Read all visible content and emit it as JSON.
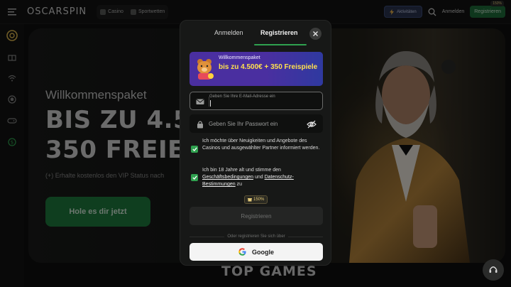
{
  "topbar": {
    "logo": "OSCARSPIN",
    "nav": [
      "Casino",
      "Sportwetten"
    ],
    "activate_label": "Aktivitäten",
    "login_label": "Anmelden",
    "register_label": "Registrieren",
    "register_badge": "150%"
  },
  "hero": {
    "subtitle": "Willkommenspaket",
    "title_line1": "BIS ZU 4.5",
    "title_line2": "350 FREIE",
    "vip": "(+) Erhalte kostenlos den VIP Status nach",
    "cta": "Hole es dir jetzt"
  },
  "section": {
    "top_games": "TOP GAMES"
  },
  "modal": {
    "tabs": {
      "login": "Anmelden",
      "register": "Registrieren",
      "active": "register"
    },
    "promo": {
      "small": "Willkommenspaket",
      "big": "bis zu 4.500€ + 350 Freispiele"
    },
    "email": {
      "label": "Geben Sie Ihre E-Mail-Adresse ein",
      "value": ""
    },
    "password": {
      "placeholder": "Geben Sie Ihr Passwort ein"
    },
    "consent_news": {
      "checked": true,
      "text": "Ich möchte über Neuigkeiten und Angebote des Casinos und ausgewählter Partner informiert werden."
    },
    "consent_terms": {
      "checked": true,
      "pre": "Ich bin 18 Jahre alt und stimme den",
      "terms_link": "Geschäftsbedingungen",
      "and": "und",
      "privacy_link": "Datenschutz-Bestimmungen",
      "post": "zu"
    },
    "bonus_badge": "150%",
    "submit": "Registrieren",
    "or_text": "Oder registrieren Sie sich über",
    "google": "Google"
  },
  "colors": {
    "accent_green": "#2fa14f",
    "promo_purple": "#4a2fa0",
    "promo_yellow": "#ffe04f"
  },
  "icons": [
    "menu-icon",
    "logo-icon",
    "casino-icon",
    "sport-icon",
    "search-icon",
    "mail-icon",
    "lock-icon",
    "eye-off-icon",
    "close-icon",
    "google-icon",
    "support-icon"
  ]
}
